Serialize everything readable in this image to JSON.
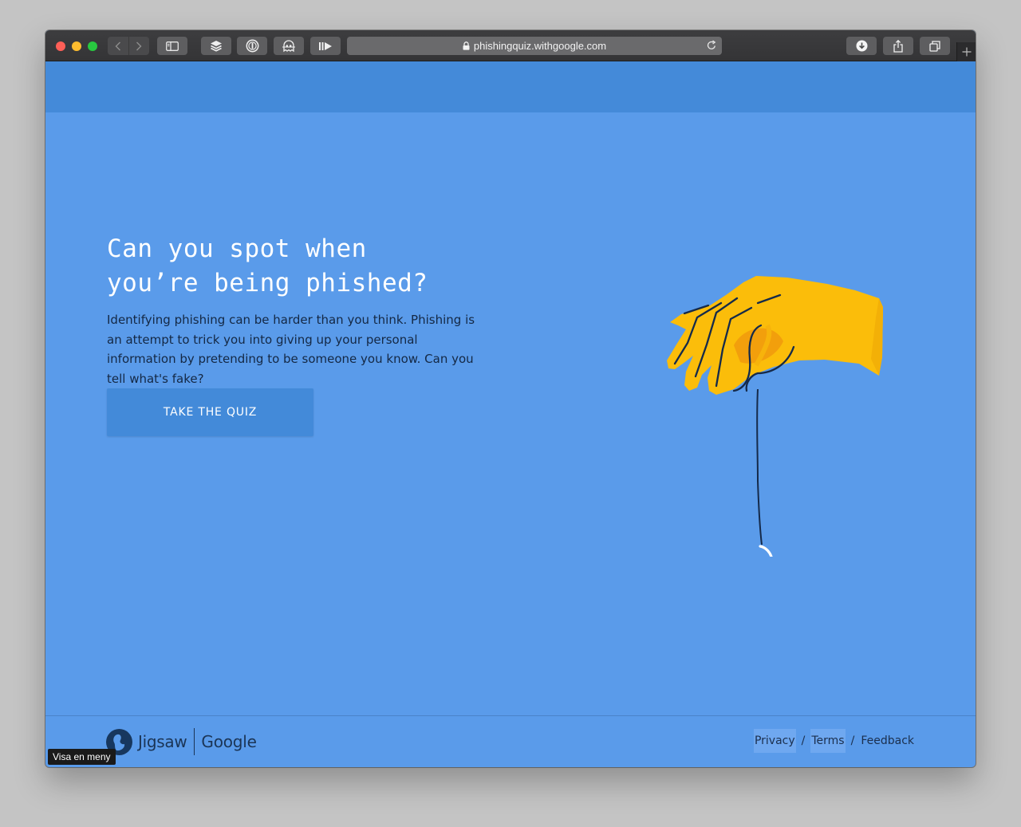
{
  "browser": {
    "url": "phishingquiz.withgoogle.com"
  },
  "hero": {
    "title_line1": "Can you spot when",
    "title_line2": "you’re being phished?",
    "description": "Identifying phishing can be harder than you think. Phishing is an attempt to trick you into giving up your personal information by pretending to be someone you know. Can you tell what's fake?",
    "cta_label": "TAKE THE QUIZ"
  },
  "footer": {
    "brand_jigsaw": "Jigsaw",
    "brand_google": "Google",
    "links": {
      "privacy": "Privacy",
      "terms": "Terms",
      "feedback": "Feedback"
    }
  },
  "tooltip": "Visa en meny",
  "colors": {
    "page_background": "#5a9bea",
    "header_band": "#448ad9",
    "button": "#438ad9",
    "hand": "#fbbd0a"
  }
}
